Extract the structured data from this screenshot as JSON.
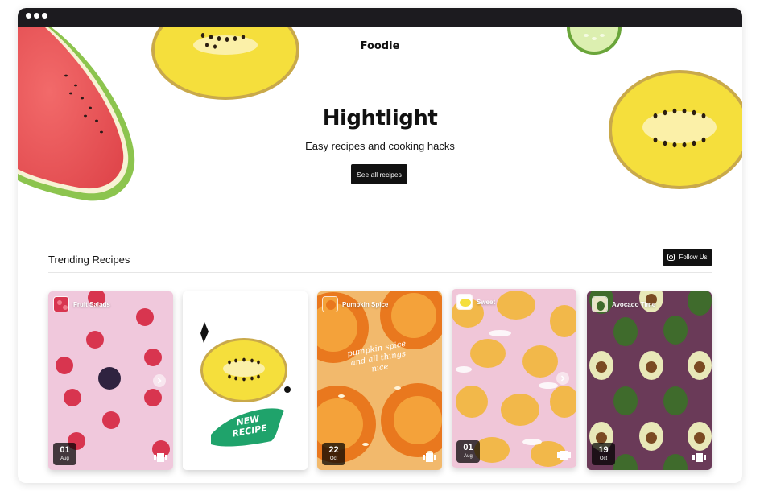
{
  "header": {
    "brand": "Foodie"
  },
  "hero": {
    "title": "Hightlight",
    "subtitle": "Easy recipes and cooking hacks",
    "cta_label": "See all recipes"
  },
  "trending": {
    "title": "Trending Recipes",
    "follow_label": "Follow Us"
  },
  "cards": [
    {
      "name": "Fruit Salads",
      "day": "01",
      "month": "Aug"
    },
    {
      "badge_text": "NEW RECIPE"
    },
    {
      "name": "Pumpkin Spice",
      "day": "22",
      "month": "Oct",
      "overlay_text": "pumpkin spice and all things nice"
    },
    {
      "name": "Sweet",
      "day": "01",
      "month": "Aug"
    },
    {
      "name": "Avocado Time",
      "day": "19",
      "month": "Oct"
    }
  ],
  "icons": {
    "window_controls": [
      "window-dot-icon",
      "window-dot-icon",
      "window-dot-icon"
    ],
    "follow": "instagram-icon",
    "gallery": "gallery-icon",
    "next": "chevron-right-icon"
  },
  "colors": {
    "dark": "#111111",
    "titlebar": "#1c1b1f",
    "new_recipe_green": "#1fa36b"
  }
}
